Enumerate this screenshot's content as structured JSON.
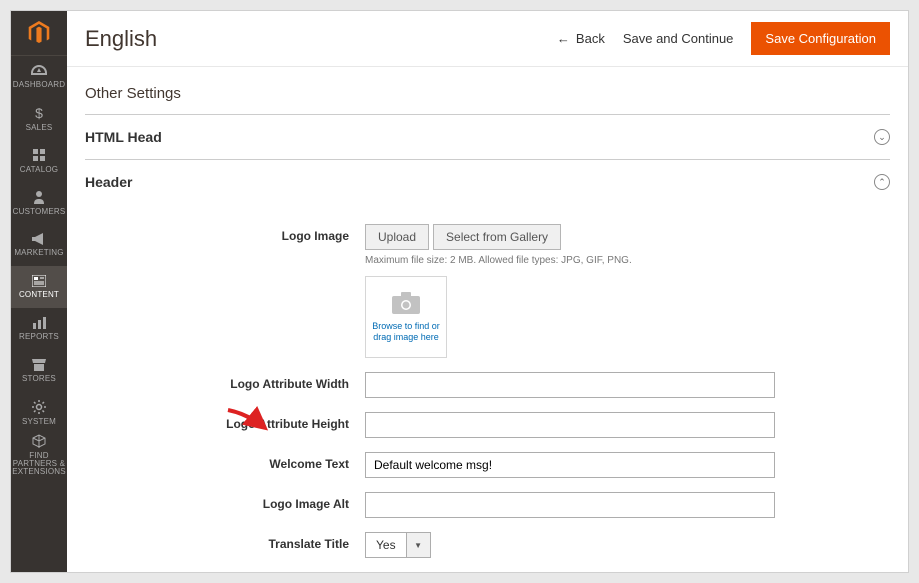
{
  "header": {
    "title": "English",
    "back": "Back",
    "save_continue": "Save and Continue",
    "save_config": "Save Configuration"
  },
  "sidebar": {
    "items": [
      {
        "label": "DASHBOARD"
      },
      {
        "label": "SALES"
      },
      {
        "label": "CATALOG"
      },
      {
        "label": "CUSTOMERS"
      },
      {
        "label": "MARKETING"
      },
      {
        "label": "CONTENT"
      },
      {
        "label": "REPORTS"
      },
      {
        "label": "STORES"
      },
      {
        "label": "SYSTEM"
      },
      {
        "label": "FIND PARTNERS & EXTENSIONS"
      }
    ]
  },
  "section": {
    "other_settings": "Other Settings",
    "html_head": "HTML Head",
    "header": "Header"
  },
  "form": {
    "logo_image_label": "Logo Image",
    "upload": "Upload",
    "select_gallery": "Select from Gallery",
    "hint": "Maximum file size: 2 MB. Allowed file types: JPG, GIF, PNG.",
    "browse_text": "Browse to find or drag image here",
    "logo_width_label": "Logo Attribute Width",
    "logo_width_value": "",
    "logo_height_label": "Logo Attribute Height",
    "logo_height_value": "",
    "welcome_label": "Welcome Text",
    "welcome_value": "Default welcome msg!",
    "logo_alt_label": "Logo Image Alt",
    "logo_alt_value": "",
    "translate_label": "Translate Title",
    "translate_value": "Yes"
  }
}
